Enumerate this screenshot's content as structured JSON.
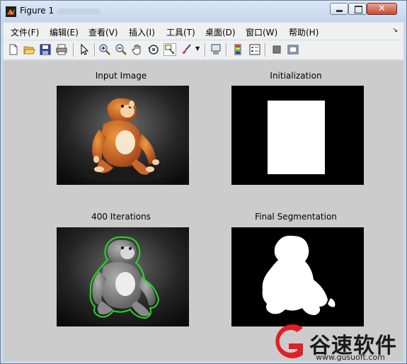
{
  "window": {
    "title": "Figure 1"
  },
  "menu": {
    "items": [
      "文件(F)",
      "编辑(E)",
      "查看(V)",
      "插入(I)",
      "工具(T)",
      "桌面(D)",
      "窗口(W)",
      "帮助(H)"
    ]
  },
  "toolbar": {
    "buttons": [
      "new-figure",
      "open-file",
      "save-figure",
      "print-figure",
      "edit-plot",
      "zoom-in",
      "zoom-out",
      "pan",
      "rotate-3d",
      "data-cursor",
      "brush",
      "link-plot",
      "insert-colorbar",
      "insert-legend",
      "hide-plot-tools",
      "show-plot-tools"
    ]
  },
  "panels": [
    {
      "title": "Input Image"
    },
    {
      "title": "Initialization"
    },
    {
      "title": "400 Iterations"
    },
    {
      "title": "Final Segmentation"
    }
  ],
  "watermark": {
    "brand": "谷速软件",
    "url": "www.gusuoft.com"
  },
  "colors": {
    "contour": "#22dd22",
    "window_bg": "#cccccc"
  }
}
